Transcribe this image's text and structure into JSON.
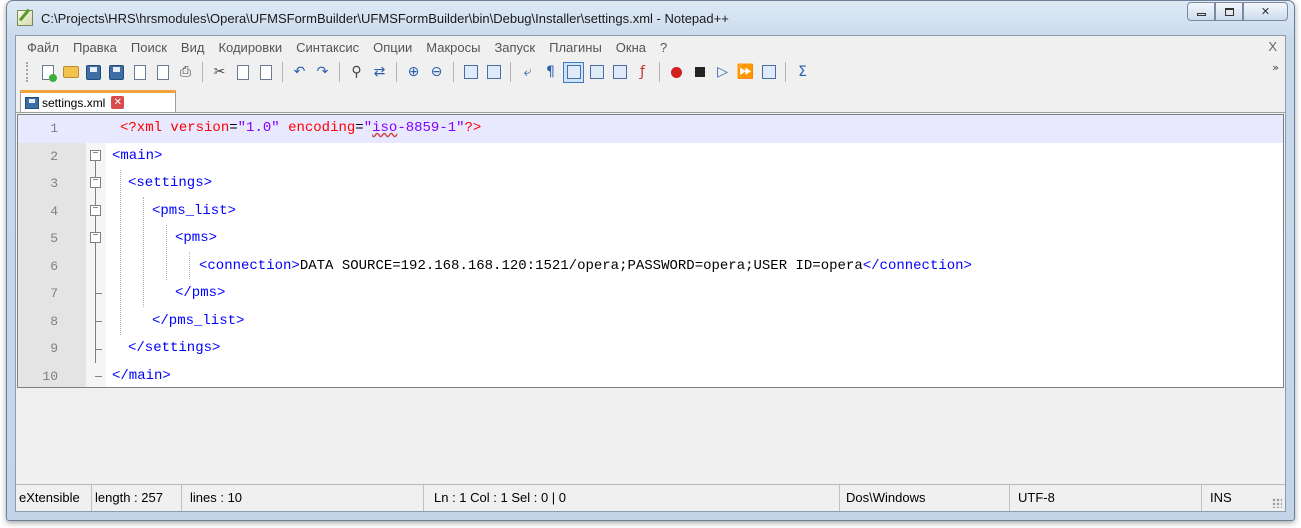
{
  "window": {
    "title": "C:\\Projects\\HRS\\hrsmodules\\Opera\\UFMSFormBuilder\\UFMSFormBuilder\\bin\\Debug\\Installer\\settings.xml - Notepad++"
  },
  "menu": {
    "items": [
      "Файл",
      "Правка",
      "Поиск",
      "Вид",
      "Кодировки",
      "Синтаксис",
      "Опции",
      "Макросы",
      "Запуск",
      "Плагины",
      "Окна",
      "?"
    ],
    "close_label": "X"
  },
  "toolbar": {
    "more_label": "»"
  },
  "tab": {
    "label": "settings.xml",
    "close_label": "✕"
  },
  "editor": {
    "line_numbers": [
      "1",
      "2",
      "3",
      "4",
      "5",
      "6",
      "7",
      "8",
      "9",
      "10"
    ],
    "current_line": 1,
    "lines": {
      "l1_pi_start": "<?xml ",
      "l1_attr1": "version",
      "l1_eq1": "=",
      "l1_val1": "\"1.0\"",
      "l1_sp": " ",
      "l1_attr2": "encoding",
      "l1_eq2": "=",
      "l1_val2a": "\"",
      "l1_val2b": "iso",
      "l1_val2c": "-8859-1\"",
      "l1_pi_end": "?>",
      "l2": "<main>",
      "l3": "<settings>",
      "l4": "<pms_list>",
      "l5": "<pms>",
      "l6_open": "<connection>",
      "l6_text": "DATA SOURCE=192.168.168.120:1521/opera;PASSWORD=opera;USER ID=opera",
      "l6_close": "</connection>",
      "l7": "</pms>",
      "l8": "</pms_list>",
      "l9": "</settings>",
      "l10": "</main>"
    }
  },
  "status": {
    "language": "eXtensible",
    "length": "length : 257",
    "lines": "lines : 10",
    "position": "Ln : 1    Col : 1    Sel : 0 | 0",
    "eol": "Dos\\Windows",
    "encoding": "UTF-8",
    "mode": "INS"
  },
  "colors": {
    "pi": "#ff0000",
    "tag": "#0000ff",
    "attribute": "#ff0000",
    "value": "#8000ff",
    "current_line": "#e8e8ff",
    "tab_accent": "#f2a33a"
  }
}
